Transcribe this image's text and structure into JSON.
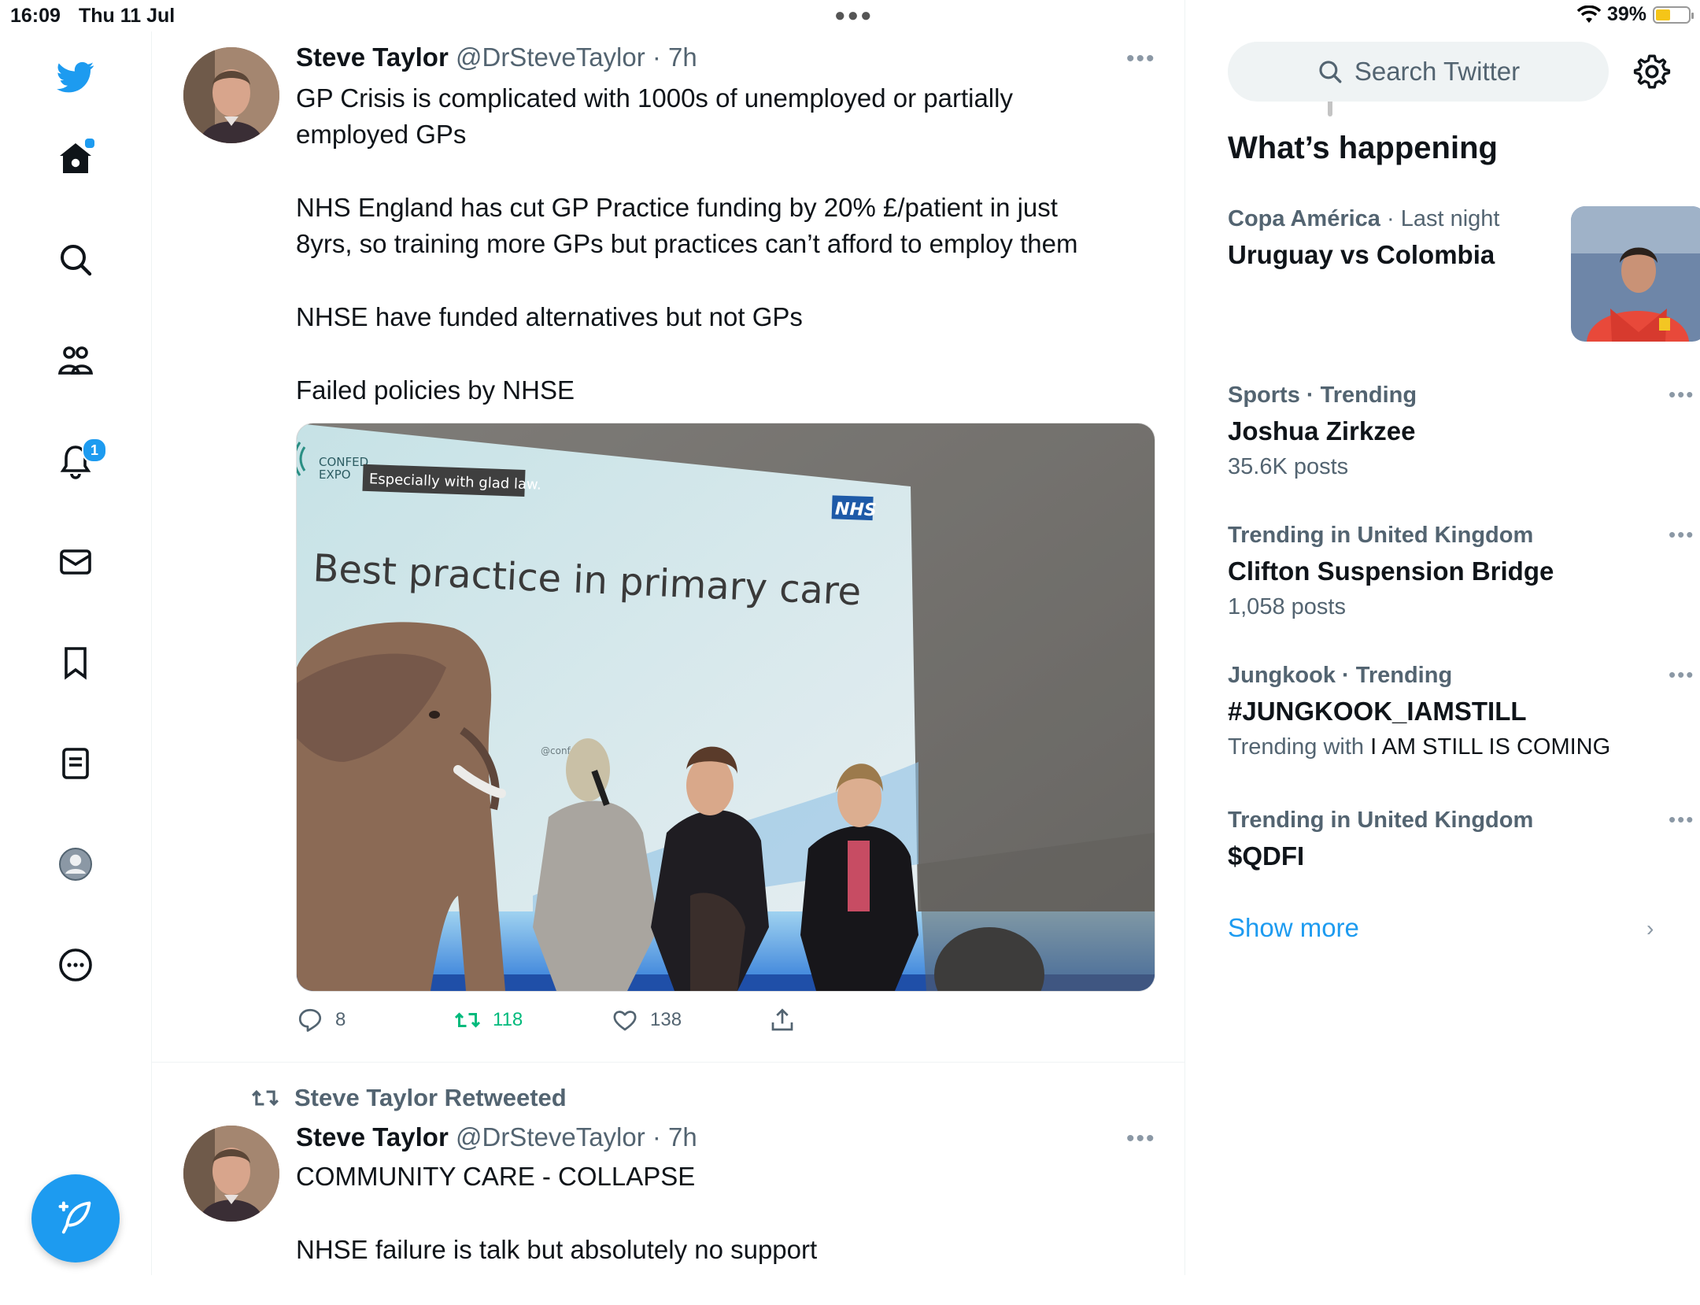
{
  "status_bar": {
    "time": "16:09",
    "date": "Thu 11 Jul",
    "battery": "39%"
  },
  "nav": {
    "notifications_badge": "1",
    "items": [
      "twitter-logo",
      "home",
      "explore",
      "communities",
      "notifications",
      "messages",
      "bookmarks",
      "lists",
      "profile",
      "more"
    ]
  },
  "tweets": [
    {
      "name": "Steve Taylor",
      "handle": "@DrSteveTaylor",
      "time": "· 7h",
      "paragraphs": [
        "GP Crisis is complicated with 1000s of unemployed or partially employed GPs",
        "NHS England has cut GP Practice funding by 20% £/patient in just 8yrs, so training more GPs but practices can’t afford to employ them",
        "NHSE have funded alternatives but not GPs",
        "Failed policies by NHSE"
      ],
      "media": {
        "logo_text_1": "CONFED",
        "logo_text_2": "EXPO",
        "caption_sticker": "Especially with glad law.",
        "screen_title": "Best practice in primary care",
        "nhs_logo": "NHS",
        "screen_handle": "@confedexpo"
      },
      "replies": "8",
      "retweets": "118",
      "likes": "138"
    },
    {
      "retweeted_by": "Steve Taylor Retweeted",
      "name": "Steve Taylor",
      "handle": "@DrSteveTaylor",
      "time": "· 7h",
      "paragraphs": [
        "COMMUNITY CARE - COLLAPSE",
        "NHSE failure is talk but absolutely no support"
      ]
    }
  ],
  "sidebar_right": {
    "search_placeholder": "Search Twitter",
    "title": "What’s happening",
    "trends": [
      {
        "category": "Copa América",
        "context": "· Last night",
        "title": "Uruguay vs Colombia"
      },
      {
        "category": "Sports · Trending",
        "title": "Joshua Zirkzee",
        "sub": "35.6K posts"
      },
      {
        "category": "Trending in United Kingdom",
        "title": "Clifton Suspension Bridge",
        "sub": "1,058 posts"
      },
      {
        "category": "Jungkook · Trending",
        "title": "#JUNGKOOK_IAMSTILL",
        "sub_prefix": "Trending with",
        "sub_highlight": "I AM STILL IS COMING"
      },
      {
        "category": "Trending in United Kingdom",
        "title": "$QDFI"
      }
    ],
    "show_more": "Show more"
  },
  "colors": {
    "accent": "#1d9bf0",
    "retweet": "#00ba7c",
    "secondary_text": "#536471"
  }
}
